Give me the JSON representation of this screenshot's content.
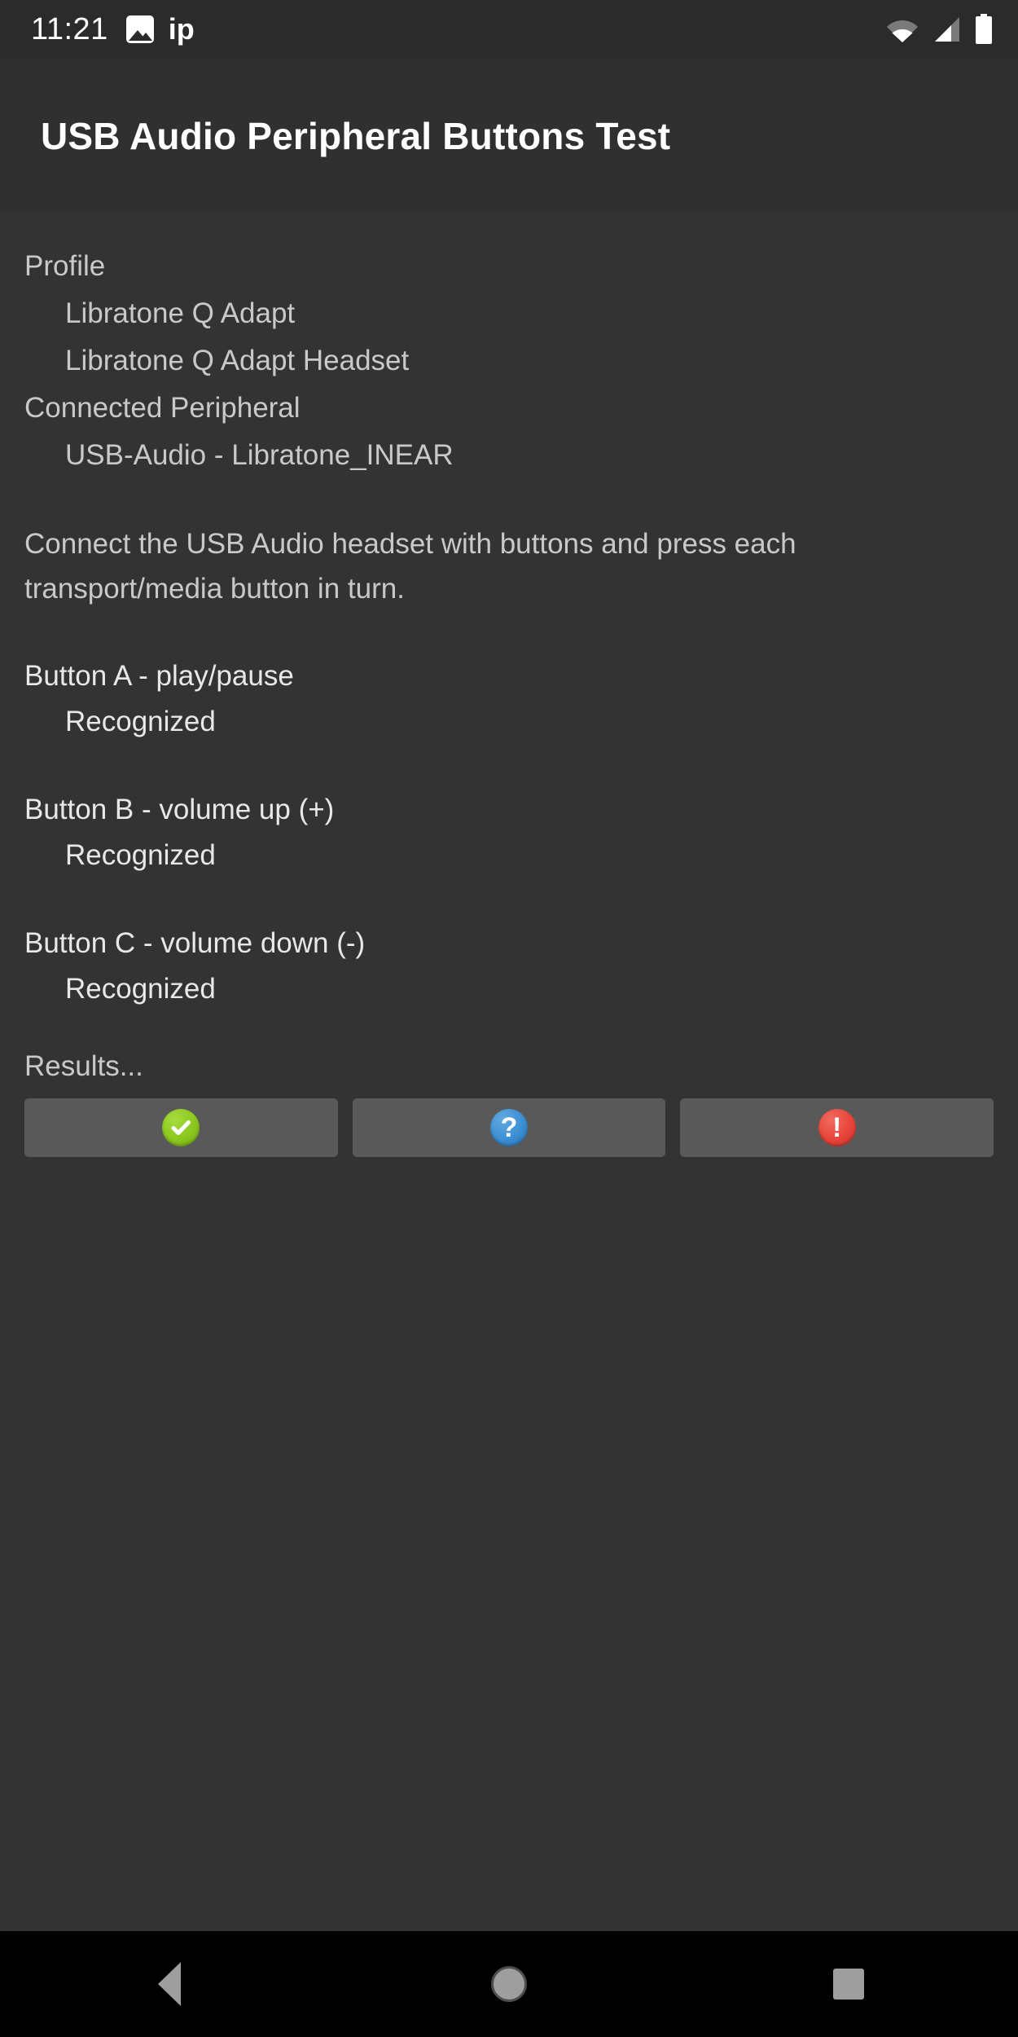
{
  "status_bar": {
    "clock": "11:21",
    "notification_text": "ip",
    "icons": [
      "image-icon",
      "wifi-icon",
      "cellular-signal-icon",
      "battery-icon"
    ]
  },
  "title_bar": {
    "title": "USB Audio Peripheral Buttons Test"
  },
  "info": {
    "profile_label": "Profile",
    "profile_values": [
      "Libratone Q Adapt",
      "Libratone Q Adapt Headset"
    ],
    "peripheral_label": "Connected Peripheral",
    "peripheral_value": "USB-Audio - Libratone_INEAR"
  },
  "instructions": "Connect the USB Audio headset with buttons and press each transport/media button in turn.",
  "buttons": [
    {
      "title": "Button A - play/pause",
      "status": "Recognized"
    },
    {
      "title": "Button B - volume up (+)",
      "status": "Recognized"
    },
    {
      "title": "Button C - volume down (-)",
      "status": "Recognized"
    }
  ],
  "results": {
    "label": "Results...",
    "actions": [
      {
        "name": "pass-button",
        "icon": "check-circle-icon",
        "glyph": "✔",
        "color": "#8bc81e"
      },
      {
        "name": "info-button",
        "icon": "question-circle-icon",
        "glyph": "?",
        "color": "#3b8fd4"
      },
      {
        "name": "fail-button",
        "icon": "alert-circle-icon",
        "glyph": "!",
        "color": "#e8443a"
      }
    ]
  },
  "nav_bar": {
    "back": "back-icon",
    "home": "home-icon",
    "recents": "recents-icon"
  }
}
